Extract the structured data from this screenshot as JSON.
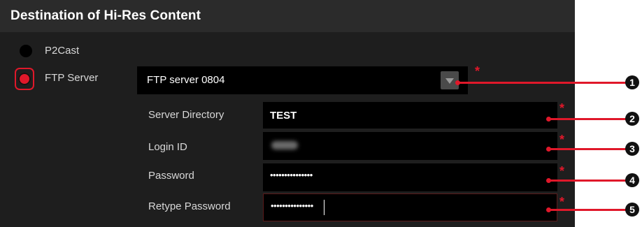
{
  "section": {
    "title": "Destination of Hi-Res Content"
  },
  "destination": {
    "options": [
      {
        "label": "P2Cast",
        "selected": false
      },
      {
        "label": "FTP Server",
        "selected": true
      }
    ],
    "ftp_server_select": {
      "value": "FTP server 0804"
    }
  },
  "fields": {
    "server_directory": {
      "label": "Server Directory",
      "value": "TEST"
    },
    "login_id": {
      "label": "Login ID",
      "value": ""
    },
    "password": {
      "label": "Password",
      "value": "•••••••••••••••"
    },
    "retype_password": {
      "label": "Retype Password",
      "value": "•••••••••••••••"
    }
  },
  "required_marker": "*",
  "callouts": [
    "1",
    "2",
    "3",
    "4",
    "5"
  ],
  "colors": {
    "accent": "#e0182a",
    "panel_bg": "#1e1e1e",
    "field_bg": "#000000"
  },
  "icons": {
    "dropdown": "triangle-down-icon"
  }
}
